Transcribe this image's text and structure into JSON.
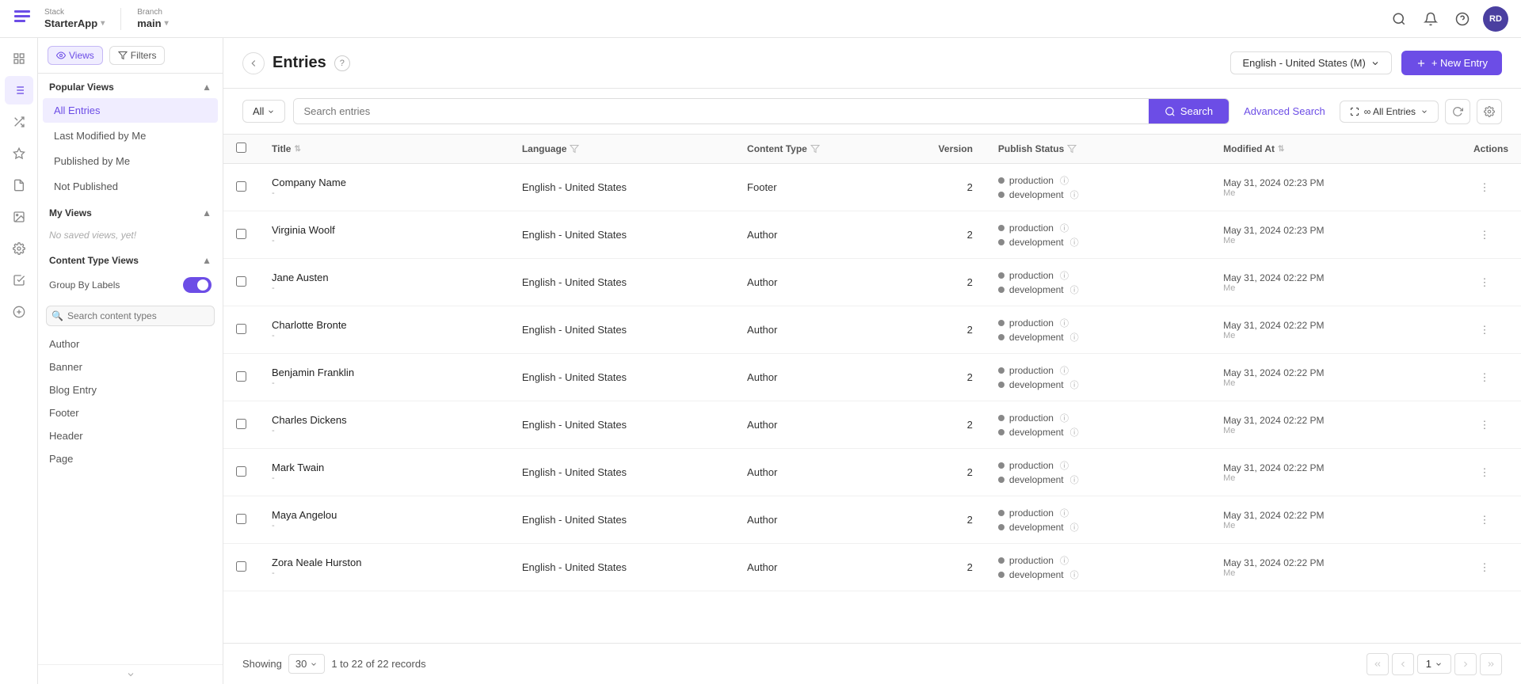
{
  "topNav": {
    "stackLabel": "Stack",
    "appName": "StarterApp",
    "appDropdown": "▾",
    "branchLabel": "Branch",
    "branchName": "main",
    "branchDropdown": "▾",
    "searchIcon": "🔍",
    "bellIcon": "🔔",
    "helpIcon": "?",
    "userInitials": "RD"
  },
  "leftPanel": {
    "viewsTab": "Views",
    "filtersTab": "Filters",
    "popularViewsTitle": "Popular Views",
    "popularViews": [
      {
        "label": "All Entries",
        "active": true
      },
      {
        "label": "Last Modified by Me",
        "active": false
      },
      {
        "label": "Published by Me",
        "active": false
      },
      {
        "label": "Not Published",
        "active": false
      }
    ],
    "myViewsTitle": "My Views",
    "noViewsText": "No saved views, yet!",
    "contentTypeViewsTitle": "Content Type Views",
    "groupByLabels": "Group By Labels",
    "searchContentTypesPlaceholder": "Search content types",
    "contentTypes": [
      {
        "label": "Author"
      },
      {
        "label": "Banner"
      },
      {
        "label": "Blog Entry"
      },
      {
        "label": "Footer"
      },
      {
        "label": "Header"
      },
      {
        "label": "Page"
      }
    ]
  },
  "entriesHeader": {
    "title": "Entries",
    "helpTooltip": "?",
    "languageSelector": "English - United States (M)",
    "newEntryBtn": "+ New Entry"
  },
  "searchBar": {
    "filterAllLabel": "All",
    "filterDropdownIcon": "▾",
    "searchPlaceholder": "Search entries",
    "searchBtnLabel": "Search",
    "advancedSearchLabel": "Advanced Search",
    "allEntriesLabel": "∞ All Entries",
    "allEntriesDropdownIcon": "▾"
  },
  "table": {
    "columns": [
      {
        "key": "title",
        "label": "Title"
      },
      {
        "key": "language",
        "label": "Language"
      },
      {
        "key": "contentType",
        "label": "Content Type"
      },
      {
        "key": "version",
        "label": "Version"
      },
      {
        "key": "publishStatus",
        "label": "Publish Status"
      },
      {
        "key": "modifiedAt",
        "label": "Modified At"
      },
      {
        "key": "actions",
        "label": "Actions"
      }
    ],
    "rows": [
      {
        "title": "Company Name",
        "subtitle": "-",
        "language": "English - United States",
        "contentType": "Footer",
        "version": "2",
        "statuses": [
          {
            "label": "production",
            "dot": "gray"
          },
          {
            "label": "development",
            "dot": "gray"
          }
        ],
        "modifiedAt": "May 31, 2024 02:23 PM",
        "modifiedBy": "Me"
      },
      {
        "title": "Virginia Woolf",
        "subtitle": "-",
        "language": "English - United States",
        "contentType": "Author",
        "version": "2",
        "statuses": [
          {
            "label": "production",
            "dot": "gray"
          },
          {
            "label": "development",
            "dot": "gray"
          }
        ],
        "modifiedAt": "May 31, 2024 02:23 PM",
        "modifiedBy": "Me"
      },
      {
        "title": "Jane Austen",
        "subtitle": "-",
        "language": "English - United States",
        "contentType": "Author",
        "version": "2",
        "statuses": [
          {
            "label": "production",
            "dot": "gray"
          },
          {
            "label": "development",
            "dot": "gray"
          }
        ],
        "modifiedAt": "May 31, 2024 02:22 PM",
        "modifiedBy": "Me"
      },
      {
        "title": "Charlotte Bronte",
        "subtitle": "-",
        "language": "English - United States",
        "contentType": "Author",
        "version": "2",
        "statuses": [
          {
            "label": "production",
            "dot": "gray"
          },
          {
            "label": "development",
            "dot": "gray"
          }
        ],
        "modifiedAt": "May 31, 2024 02:22 PM",
        "modifiedBy": "Me"
      },
      {
        "title": "Benjamin Franklin",
        "subtitle": "-",
        "language": "English - United States",
        "contentType": "Author",
        "version": "2",
        "statuses": [
          {
            "label": "production",
            "dot": "gray"
          },
          {
            "label": "development",
            "dot": "gray"
          }
        ],
        "modifiedAt": "May 31, 2024 02:22 PM",
        "modifiedBy": "Me"
      },
      {
        "title": "Charles Dickens",
        "subtitle": "-",
        "language": "English - United States",
        "contentType": "Author",
        "version": "2",
        "statuses": [
          {
            "label": "production",
            "dot": "gray"
          },
          {
            "label": "development",
            "dot": "gray"
          }
        ],
        "modifiedAt": "May 31, 2024 02:22 PM",
        "modifiedBy": "Me"
      },
      {
        "title": "Mark Twain",
        "subtitle": "-",
        "language": "English - United States",
        "contentType": "Author",
        "version": "2",
        "statuses": [
          {
            "label": "production",
            "dot": "gray"
          },
          {
            "label": "development",
            "dot": "gray"
          }
        ],
        "modifiedAt": "May 31, 2024 02:22 PM",
        "modifiedBy": "Me"
      },
      {
        "title": "Maya Angelou",
        "subtitle": "-",
        "language": "English - United States",
        "contentType": "Author",
        "version": "2",
        "statuses": [
          {
            "label": "production",
            "dot": "gray"
          },
          {
            "label": "development",
            "dot": "gray"
          }
        ],
        "modifiedAt": "May 31, 2024 02:22 PM",
        "modifiedBy": "Me"
      },
      {
        "title": "Zora Neale Hurston",
        "subtitle": "-",
        "language": "English - United States",
        "contentType": "Author",
        "version": "2",
        "statuses": [
          {
            "label": "production",
            "dot": "gray"
          },
          {
            "label": "development",
            "dot": "gray"
          }
        ],
        "modifiedAt": "May 31, 2024 02:22 PM",
        "modifiedBy": "Me"
      }
    ]
  },
  "pagination": {
    "showingLabel": "Showing",
    "perPage": "30",
    "perPageDropdown": "▾",
    "recordsInfo": "1 to 22 of 22 records",
    "currentPage": "1",
    "pageDropdown": "▾"
  },
  "iconSidebar": {
    "items": [
      {
        "icon": "⊞",
        "name": "grid-icon"
      },
      {
        "icon": "☰",
        "name": "list-icon"
      },
      {
        "icon": "◈",
        "name": "modules-icon"
      },
      {
        "icon": "⬡",
        "name": "hex-icon"
      },
      {
        "icon": "≋",
        "name": "entries-icon"
      },
      {
        "icon": "⊛",
        "name": "media-icon"
      },
      {
        "icon": "⋯",
        "name": "more-icon"
      },
      {
        "icon": "☑",
        "name": "tasks-icon"
      },
      {
        "icon": "⊕",
        "name": "add-icon"
      }
    ]
  }
}
